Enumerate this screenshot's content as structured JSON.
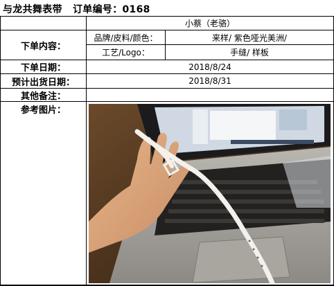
{
  "header": {
    "company": "与龙共舞表带",
    "order_label": "订单编号：",
    "order_no": "0168"
  },
  "customer": "小蔡（老骆）",
  "order_content": {
    "label": "下单内容：",
    "brand_label": "品牌/皮料/颜色：",
    "brand_value": "来样/ 紫色哑光美洲/",
    "craft_label": "工艺/Logo：",
    "craft_value": "手缝/ 样板"
  },
  "order_date": {
    "label": "下单日期：",
    "value": "2018/8/24"
  },
  "ship_date": {
    "label": "预计出货日期：",
    "value": "2018/8/31"
  },
  "remarks": {
    "label": "其他备注：",
    "value": ""
  },
  "reference": {
    "label": "参考图片："
  },
  "colors": {
    "border": "#000000",
    "bg": "#ffffff"
  }
}
